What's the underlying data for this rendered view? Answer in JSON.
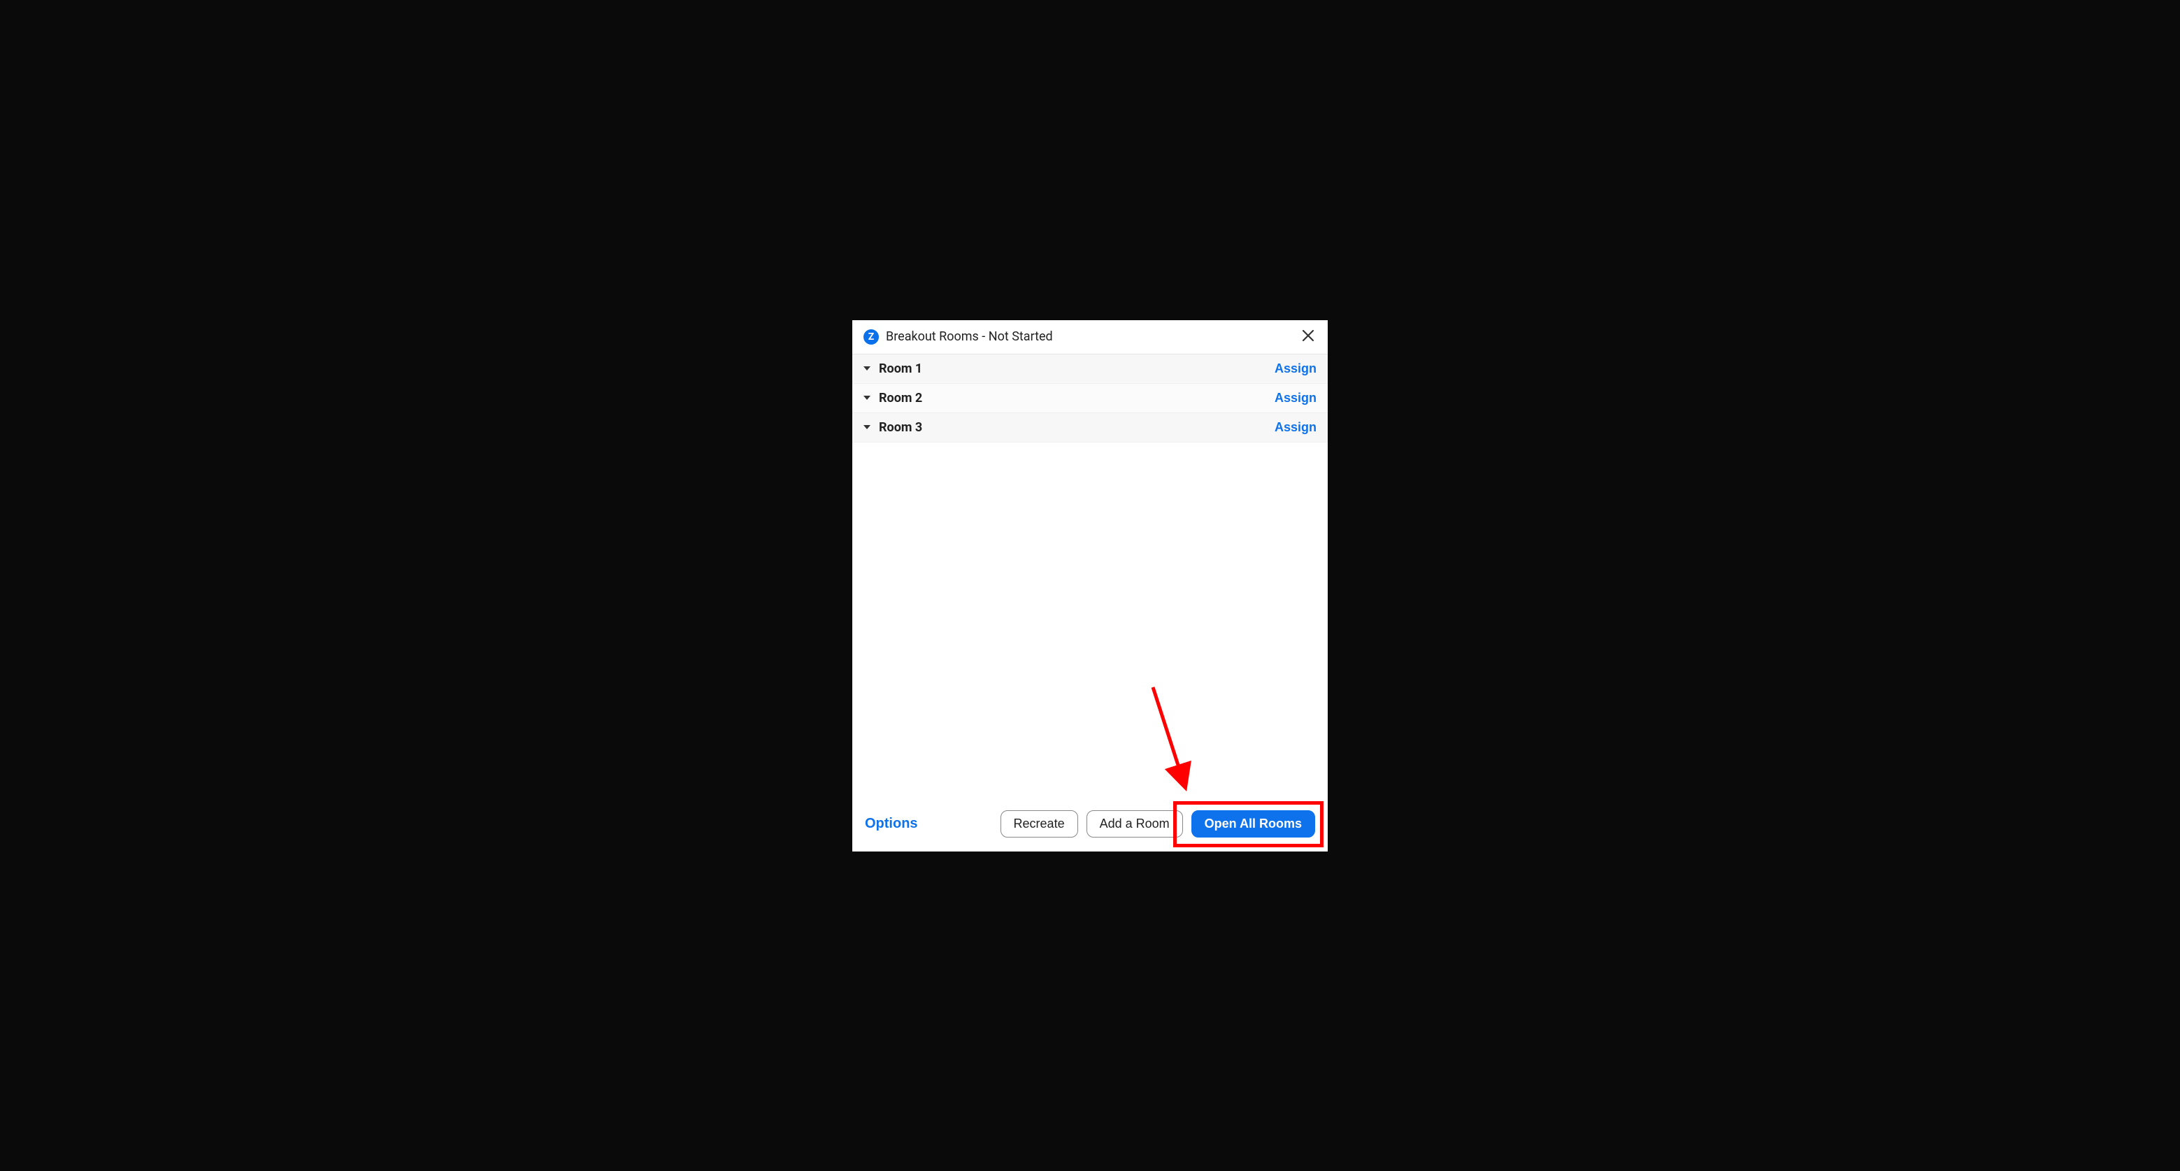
{
  "dialog": {
    "title": "Breakout Rooms - Not Started",
    "rooms": [
      {
        "name": "Room 1",
        "assign_label": "Assign"
      },
      {
        "name": "Room 2",
        "assign_label": "Assign"
      },
      {
        "name": "Room 3",
        "assign_label": "Assign"
      }
    ],
    "footer": {
      "options_label": "Options",
      "recreate_label": "Recreate",
      "add_room_label": "Add a Room",
      "open_all_label": "Open All Rooms"
    }
  }
}
